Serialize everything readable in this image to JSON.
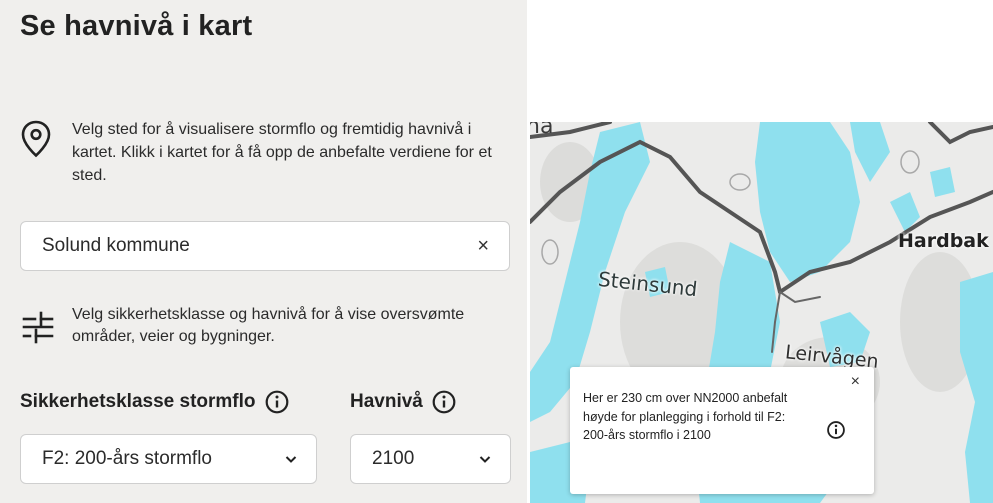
{
  "panel": {
    "title": "Se havnivå i kart",
    "location_hint": "Velg sted for å visualisere stormflo og fremtidig havnivå i kartet. Klikk i kartet for å få opp de anbefalte verdiene for et sted.",
    "search": {
      "value": "Solund kommune",
      "clear_symbol": "×"
    },
    "filter_hint": "Velg sikkerhetsklasse og havnivå for å vise oversvømte områder, veier og bygninger.",
    "safety_class": {
      "label": "Sikkerhetsklasse stormflo",
      "selected": "F2: 200-års stormflo"
    },
    "sea_level": {
      "label": "Havnivå",
      "selected": "2100"
    }
  },
  "map": {
    "place_labels": {
      "partial_top_left": "na",
      "steinsund": "Steinsund",
      "hardbak": "Hardbak",
      "leirvagen": "Leirvågen"
    },
    "colors": {
      "water": "#8fe0ee",
      "land": "#ebebea",
      "road": "#555555"
    },
    "popup": {
      "text": "Her er 230 cm over NN2000 anbefalt høyde for planlegging i forhold til F2: 200-års stormflo i 2100",
      "close_symbol": "×"
    }
  },
  "icons": {
    "location": "location-pin-icon",
    "filter": "sliders-icon",
    "info": "info-circle-icon",
    "chevron": "chevron-down-icon"
  }
}
